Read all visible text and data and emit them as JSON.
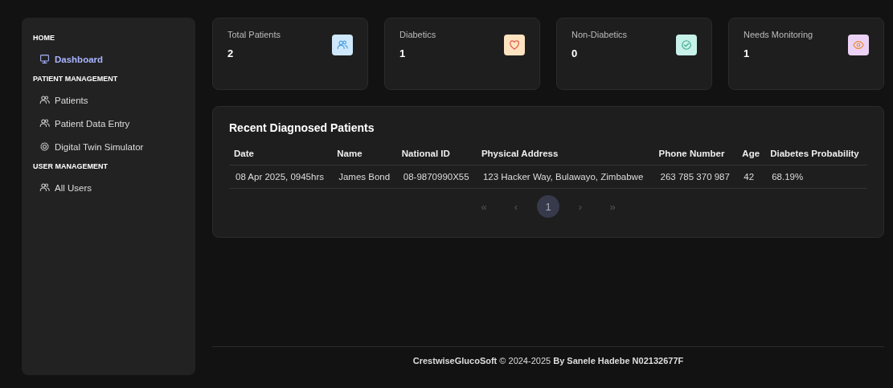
{
  "sidebar": {
    "sections": [
      {
        "heading": "HOME",
        "items": [
          {
            "label": "Dashboard",
            "kind": "monitor",
            "selected": true
          }
        ]
      },
      {
        "heading": "PATIENT MANAGEMENT",
        "items": [
          {
            "label": "Patients",
            "kind": "users",
            "selected": false
          },
          {
            "label": "Patient Data Entry",
            "kind": "users",
            "selected": false
          },
          {
            "label": "Digital Twin Simulator",
            "kind": "gear",
            "selected": false
          }
        ]
      },
      {
        "heading": "USER MANAGEMENT",
        "items": [
          {
            "label": "All Users",
            "kind": "users",
            "selected": false
          }
        ]
      }
    ]
  },
  "stats": [
    {
      "label": "Total Patients",
      "value": "2",
      "kind": "users",
      "color": "#cfe8fb"
    },
    {
      "label": "Diabetics",
      "value": "1",
      "kind": "heart",
      "color": "#fde3c0"
    },
    {
      "label": "Non-Diabetics",
      "value": "0",
      "kind": "check",
      "color": "#c8f1ea"
    },
    {
      "label": "Needs Monitoring",
      "value": "1",
      "kind": "eye",
      "color": "#ecd3f5"
    }
  ],
  "table": {
    "title": "Recent Diagnosed Patients",
    "columns": [
      "Date",
      "Name",
      "National ID",
      "Physical Address",
      "Phone Number",
      "Age",
      "Diabetes Probability"
    ],
    "rows": [
      [
        "08 Apr 2025, 0945hrs",
        "James Bond",
        "08-9870990X55",
        "123 Hacker Way, Bulawayo, Zimbabwe",
        "263 785 370 987",
        "42",
        "68.19%"
      ]
    ]
  },
  "pagination": [
    {
      "label": "«",
      "selected": false
    },
    {
      "label": "‹",
      "selected": false
    },
    {
      "label": "1",
      "selected": true
    },
    {
      "label": "›",
      "selected": false
    },
    {
      "label": "»",
      "selected": false
    }
  ],
  "footer": "**CrestwiseGlucoSoft**   © 2024-2025  **By Sanele Hadebe N02132677F**"
}
